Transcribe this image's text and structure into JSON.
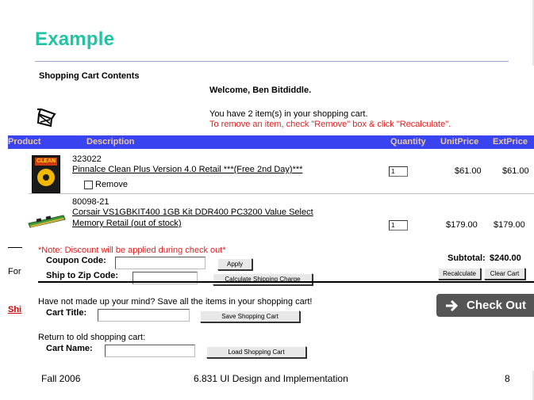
{
  "slide": {
    "title": "Example",
    "footer_left": "Fall 2006",
    "footer_center": "6.831 UI Design and Implementation",
    "page_number": "8"
  },
  "cart": {
    "heading": "Shopping Cart Contents",
    "welcome": "Welcome, Ben Bitdiddle.",
    "item_count_text": "You have 2 item(s) in your shopping cart.",
    "remove_instructions": "To remove an item, check \"Remove\" box & click \"Recalculate\".",
    "columns": {
      "product": "Product",
      "description": "Description",
      "quantity": "Quantity",
      "unit_price": "UnitPrice",
      "ext_price": "ExtPrice"
    },
    "items": [
      {
        "sku": "323022",
        "name": "Pinnalce Clean Plus Version 4.0 Retail ***(Free 2nd Day)***",
        "quantity": "1",
        "unit_price": "$61.00",
        "ext_price": "$61.00",
        "remove_label": "Remove",
        "box_label": "CLEAN"
      },
      {
        "sku": "80098-21",
        "name_line1": "Corsair VS1GBKIT400 1GB Kit DDR400 PC3200 Value Select",
        "name_line2": "Memory Retail (out of stock)",
        "quantity": "1",
        "unit_price": "$179.00",
        "ext_price": "$179.00"
      }
    ],
    "discount_note": "*Note: Discount will be applied during check out*",
    "coupon_label": "Coupon Code:",
    "apply_button": "Apply",
    "zip_label": "Ship to Zip Code:",
    "shipping_button": "Calculate Shipping Charge",
    "subtotal_label": "Subtotal:",
    "subtotal_value": "$240.00",
    "recalculate_button": "Recalculate",
    "clear_cart_button": "Clear Cart",
    "left_cut_text_1": "For",
    "left_cut_text_2": "Shi",
    "checkout_button": "Check Out",
    "save_prompt": "Have not made up your mind? Save all the items in your shopping cart!",
    "cart_title_label": "Cart Title:",
    "save_button": "Save Shopping Cart",
    "return_prompt": "Return to old shopping cart:",
    "cart_name_label": "Cart Name:",
    "load_button": "Load Shopping Cart",
    "colors": {
      "header_bg": "#3a43f0",
      "header_text": "#e8c99b",
      "title": "#20c4a4",
      "note_red": "#e02020",
      "checkout_bg": "#555555"
    }
  }
}
